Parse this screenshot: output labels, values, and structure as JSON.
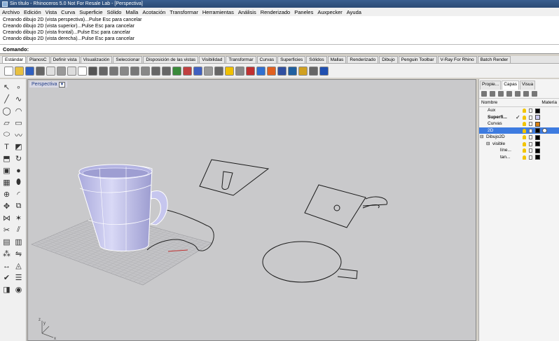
{
  "window": {
    "title": "Sin título - Rhinoceros 5.0 Not For Resale Lab - [Perspectiva]"
  },
  "menu": [
    "Archivo",
    "Edición",
    "Vista",
    "Curva",
    "Superficie",
    "Sólido",
    "Malla",
    "Acotación",
    "Transformar",
    "Herramientas",
    "Análisis",
    "Renderizado",
    "Paneles",
    "Auxpecker",
    "Ayuda"
  ],
  "history": [
    "Creando dibujo 2D (vista perspectiva)...Pulse Esc para cancelar",
    "Creando dibujo 2D (vista superior)...Pulse Esc para cancelar",
    "Creando dibujo 2D (vista frontal)...Pulse Esc para cancelar",
    "Creando dibujo 2D (vista derecha)...Pulse Esc para cancelar"
  ],
  "command": {
    "label": "Comando:"
  },
  "tabs": [
    "Estándar",
    "PlanosC",
    "Definir vista",
    "Visualización",
    "Seleccionar",
    "Disposición de las vistas",
    "Visibilidad",
    "Transformar",
    "Curvas",
    "Superficies",
    "Sólidos",
    "Mallas",
    "Renderizado",
    "Dibujo",
    "Penguin Toolbar",
    "V-Ray For Rhino",
    "Batch Render"
  ],
  "viewport": {
    "label": "Perspectiva",
    "axis_x": "x",
    "axis_y": "y",
    "axis_z": "z"
  },
  "panel": {
    "tabs": [
      "Propie...",
      "Capas",
      "Visua"
    ],
    "col_name": "Nombre",
    "col_material": "Materia",
    "layers": [
      {
        "name": "Aux",
        "indent": 0,
        "color": "#000000",
        "current": false,
        "bold": false,
        "selected": false
      },
      {
        "name": "Superfi...",
        "indent": 0,
        "color": "#c8c8f0",
        "current": true,
        "bold": true,
        "selected": false
      },
      {
        "name": "Curvas",
        "indent": 0,
        "color": "#d88010",
        "current": false,
        "bold": false,
        "selected": false
      },
      {
        "name": "2D",
        "indent": 0,
        "color": "#000000",
        "current": false,
        "bold": false,
        "selected": true
      },
      {
        "name": "Dibujo2D",
        "indent": 0,
        "color": "#000000",
        "current": false,
        "bold": false,
        "selected": false,
        "expander": "⊟"
      },
      {
        "name": "visible",
        "indent": 1,
        "color": "#000000",
        "current": false,
        "bold": false,
        "selected": false,
        "expander": "⊟"
      },
      {
        "name": "líne...",
        "indent": 2,
        "color": "#000000",
        "current": false,
        "bold": false,
        "selected": false
      },
      {
        "name": "tan...",
        "indent": 2,
        "color": "#000000",
        "current": false,
        "bold": false,
        "selected": false
      }
    ]
  },
  "colors": {
    "accent": "#3d7be0",
    "viewport_bg": "#c9c9cb",
    "cup_fill": "#bfbfe8",
    "cup_stroke": "#ffffff"
  }
}
